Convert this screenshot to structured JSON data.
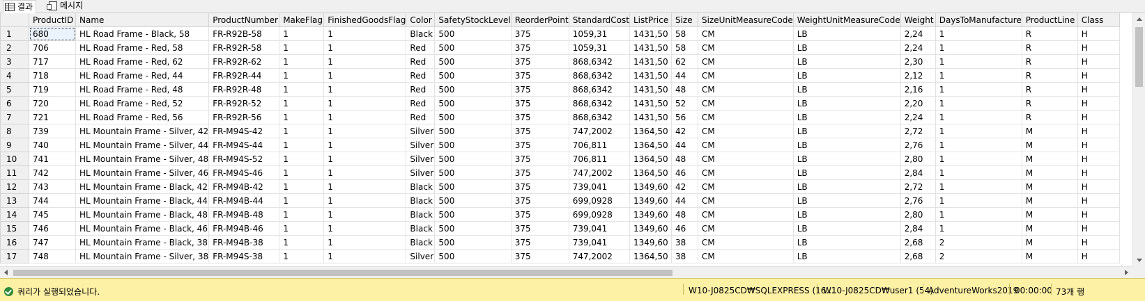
{
  "tabs": [
    {
      "label": "결과",
      "icon": "grid-icon",
      "active": true
    },
    {
      "label": "메시지",
      "icon": "messages-icon",
      "active": false
    }
  ],
  "grid": {
    "columns": [
      "ProductID",
      "Name",
      "ProductNumber",
      "MakeFlag",
      "FinishedGoodsFlag",
      "Color",
      "SafetyStockLevel",
      "ReorderPoint",
      "StandardCost",
      "ListPrice",
      "Size",
      "SizeUnitMeasureCode",
      "WeightUnitMeasureCode",
      "Weight",
      "DaysToManufacture",
      "ProductLine",
      "Class"
    ],
    "rows": [
      [
        "1",
        "680",
        "HL Road Frame - Black, 58",
        "FR-R92B-58",
        "1",
        "1",
        "Black",
        "500",
        "375",
        "1059,31",
        "1431,50",
        "58",
        "CM",
        "LB",
        "2,24",
        "1",
        "R",
        "H"
      ],
      [
        "2",
        "706",
        "HL Road Frame - Red, 58",
        "FR-R92R-58",
        "1",
        "1",
        "Red",
        "500",
        "375",
        "1059,31",
        "1431,50",
        "58",
        "CM",
        "LB",
        "2,24",
        "1",
        "R",
        "H"
      ],
      [
        "3",
        "717",
        "HL Road Frame - Red, 62",
        "FR-R92R-62",
        "1",
        "1",
        "Red",
        "500",
        "375",
        "868,6342",
        "1431,50",
        "62",
        "CM",
        "LB",
        "2,30",
        "1",
        "R",
        "H"
      ],
      [
        "4",
        "718",
        "HL Road Frame - Red, 44",
        "FR-R92R-44",
        "1",
        "1",
        "Red",
        "500",
        "375",
        "868,6342",
        "1431,50",
        "44",
        "CM",
        "LB",
        "2,12",
        "1",
        "R",
        "H"
      ],
      [
        "5",
        "719",
        "HL Road Frame - Red, 48",
        "FR-R92R-48",
        "1",
        "1",
        "Red",
        "500",
        "375",
        "868,6342",
        "1431,50",
        "48",
        "CM",
        "LB",
        "2,16",
        "1",
        "R",
        "H"
      ],
      [
        "6",
        "720",
        "HL Road Frame - Red, 52",
        "FR-R92R-52",
        "1",
        "1",
        "Red",
        "500",
        "375",
        "868,6342",
        "1431,50",
        "52",
        "CM",
        "LB",
        "2,20",
        "1",
        "R",
        "H"
      ],
      [
        "7",
        "721",
        "HL Road Frame - Red, 56",
        "FR-R92R-56",
        "1",
        "1",
        "Red",
        "500",
        "375",
        "868,6342",
        "1431,50",
        "56",
        "CM",
        "LB",
        "2,24",
        "1",
        "R",
        "H"
      ],
      [
        "8",
        "739",
        "HL Mountain Frame - Silver, 42",
        "FR-M94S-42",
        "1",
        "1",
        "Silver",
        "500",
        "375",
        "747,2002",
        "1364,50",
        "42",
        "CM",
        "LB",
        "2,72",
        "1",
        "M",
        "H"
      ],
      [
        "9",
        "740",
        "HL Mountain Frame - Silver, 44",
        "FR-M94S-44",
        "1",
        "1",
        "Silver",
        "500",
        "375",
        "706,811",
        "1364,50",
        "44",
        "CM",
        "LB",
        "2,76",
        "1",
        "M",
        "H"
      ],
      [
        "10",
        "741",
        "HL Mountain Frame - Silver, 48",
        "FR-M94S-52",
        "1",
        "1",
        "Silver",
        "500",
        "375",
        "706,811",
        "1364,50",
        "48",
        "CM",
        "LB",
        "2,80",
        "1",
        "M",
        "H"
      ],
      [
        "11",
        "742",
        "HL Mountain Frame - Silver, 46",
        "FR-M94S-46",
        "1",
        "1",
        "Silver",
        "500",
        "375",
        "747,2002",
        "1364,50",
        "46",
        "CM",
        "LB",
        "2,84",
        "1",
        "M",
        "H"
      ],
      [
        "12",
        "743",
        "HL Mountain Frame - Black, 42",
        "FR-M94B-42",
        "1",
        "1",
        "Black",
        "500",
        "375",
        "739,041",
        "1349,60",
        "42",
        "CM",
        "LB",
        "2,72",
        "1",
        "M",
        "H"
      ],
      [
        "13",
        "744",
        "HL Mountain Frame - Black, 44",
        "FR-M94B-44",
        "1",
        "1",
        "Black",
        "500",
        "375",
        "699,0928",
        "1349,60",
        "44",
        "CM",
        "LB",
        "2,76",
        "1",
        "M",
        "H"
      ],
      [
        "14",
        "745",
        "HL Mountain Frame - Black, 48",
        "FR-M94B-48",
        "1",
        "1",
        "Black",
        "500",
        "375",
        "699,0928",
        "1349,60",
        "48",
        "CM",
        "LB",
        "2,80",
        "1",
        "M",
        "H"
      ],
      [
        "15",
        "746",
        "HL Mountain Frame - Black, 46",
        "FR-M94B-46",
        "1",
        "1",
        "Black",
        "500",
        "375",
        "739,041",
        "1349,60",
        "46",
        "CM",
        "LB",
        "2,84",
        "1",
        "M",
        "H"
      ],
      [
        "16",
        "747",
        "HL Mountain Frame - Black, 38",
        "FR-M94B-38",
        "1",
        "1",
        "Black",
        "500",
        "375",
        "739,041",
        "1349,60",
        "38",
        "CM",
        "LB",
        "2,68",
        "2",
        "M",
        "H"
      ],
      [
        "17",
        "748",
        "HL Mountain Frame - Silver, 38",
        "FR-M94S-38",
        "1",
        "1",
        "Silver",
        "500",
        "375",
        "747,2002",
        "1364,50",
        "38",
        "CM",
        "LB",
        "2,68",
        "2",
        "M",
        "H"
      ]
    ]
  },
  "status": {
    "message": "쿼리가 실행되었습니다.",
    "server": "W10-J0825CD₩SQLEXPRESS (16....",
    "user": "W10-J0825CD₩user1 (54)",
    "database": "AdventureWorks2019",
    "elapsed": "00:00:00",
    "rowcount": "73개 행",
    "bg_color": "#fdf1a6",
    "icon": "check-circle-icon"
  }
}
